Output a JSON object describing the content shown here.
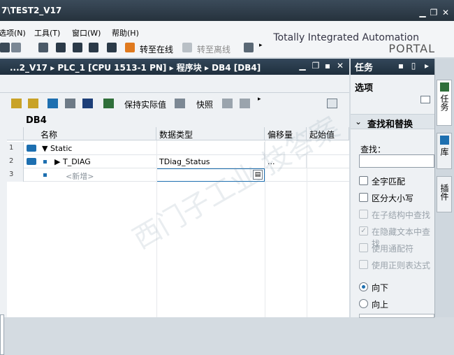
{
  "window": {
    "title": "7\\TEST2_V17"
  },
  "menu": {
    "items": [
      "选项(N)",
      "工具(T)",
      "窗口(W)",
      "帮助(H)"
    ]
  },
  "toolbar": {
    "go_online": "转至在线",
    "go_offline": "转至离线"
  },
  "brand": {
    "line1": "Totally Integrated Automation",
    "line2": "PORTAL"
  },
  "editor": {
    "breadcrumb": "...2_V17 ▸ PLC_1 [CPU 1513-1 PN] ▸ 程序块 ▸ DB4 [DB4]",
    "toolbar": {
      "keep_actual": "保持实际值",
      "snapshot": "快照"
    },
    "block_name": "DB4",
    "columns": [
      "名称",
      "数据类型",
      "偏移量",
      "起始值"
    ],
    "rows": [
      {
        "num": "1",
        "name": "Static",
        "type": "",
        "offset": "",
        "start": ""
      },
      {
        "num": "2",
        "name": "T_DIAG",
        "type": "TDiag_Status",
        "offset": "...",
        "start": ""
      },
      {
        "num": "3",
        "name": "<新增>",
        "type": "",
        "offset": "",
        "start": ""
      }
    ]
  },
  "tasks": {
    "header": "任务",
    "title": "选项",
    "section": "查找和替换",
    "find_label": "查找：",
    "find_value": "",
    "options": [
      {
        "label": "全字匹配",
        "enabled": true,
        "checked": false
      },
      {
        "label": "区分大小写",
        "enabled": true,
        "checked": false
      },
      {
        "label": "在子结构中查找",
        "enabled": false,
        "checked": false
      },
      {
        "label": "在隐藏文本中查找",
        "enabled": false,
        "checked": true
      },
      {
        "label": "使用通配符",
        "enabled": false,
        "checked": false
      },
      {
        "label": "使用正则表达式",
        "enabled": false,
        "checked": false
      }
    ],
    "direction": [
      {
        "label": "向下",
        "selected": true
      },
      {
        "label": "向上",
        "selected": false
      }
    ]
  },
  "side_tabs": [
    "任务",
    "库",
    "插件"
  ],
  "colors": {
    "header_dark": "#26323d",
    "accent_blue": "#1d6fb0",
    "panel_bg": "#eef1f4"
  }
}
